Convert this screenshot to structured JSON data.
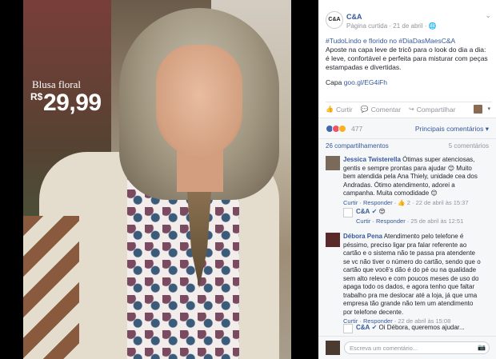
{
  "photo": {
    "caption": "Blusa floral",
    "currency": "R$",
    "price": "29,99"
  },
  "post": {
    "page_name": "C&A",
    "logo_text": "C&A",
    "meta": "Página curtida · 21 de abril · ",
    "hashtags": "#TudoLindo e florido no #DiaDasMaesC&A",
    "body": "Aposte na capa leve de tricô para o look do dia a dia: é leve, confortável e perfeita para misturar com peças estampadas e divertidas.",
    "link_prefix": "Capa ",
    "link": "goo.gl/EG4iFh"
  },
  "actions": {
    "like": "Curtir",
    "comment": "Comentar",
    "share": "Compartilhar"
  },
  "reactions": {
    "count": "477",
    "sort_label": "Principais comentários ▾",
    "colors": [
      "#4267b2",
      "#f25268",
      "#f7b125"
    ]
  },
  "shares": {
    "left": "26 compartilhamentos",
    "right": "5 comentários"
  },
  "comments": [
    {
      "author": "Jessica Twisterella",
      "text": "Ótimas super atenciosas, gentis e sempre prontas para ajudar 😊 Muito bem atendida pela Ana Thiely, unidade cea dos Andradas. Ótimo atendimento, adorei a campanha. Muita comodidade 😊",
      "meta_reply": "Curtir · Responder · ",
      "meta_likes": "👍 2 · 22 de abril às 15:37"
    },
    {
      "author": "C&A",
      "text": "😍",
      "meta_reply": "Curtir · Responder · ",
      "meta_likes": "25 de abril às 12:51"
    },
    {
      "author": "Débora Pena",
      "text": "Atendimento pelo telefone é péssimo, preciso ligar pra falar referente ao cartão e o sistema não te passa pra atendente se vc não tiver o número do cartão, sendo que o cartão que você's dão é do pé ou na qualidade sem alto relevo e com poucos meses de uso do apaga todo os dados, e agora tenho que faltar trabalho pra me deslocar até a loja, já que uma empresa tão grande não tem um atendimento por telefone decente.",
      "meta_reply": "Curtir · Responder · ",
      "meta_likes": "22 de abril às 15:08"
    },
    {
      "author": "C&A",
      "text": "Oi Débora, queremos ajudar...",
      "meta_reply": "",
      "meta_likes": ""
    }
  ],
  "composer": {
    "placeholder": "Escreva um comentário..."
  }
}
